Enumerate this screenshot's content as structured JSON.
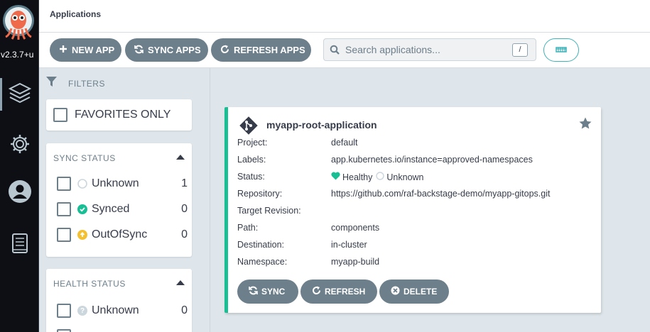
{
  "nav": {
    "version": "v2.3.7+u",
    "items": [
      "applications-icon",
      "settings-icon",
      "user-icon",
      "docs-icon"
    ]
  },
  "header": {
    "title": "Applications"
  },
  "toolbar": {
    "new_app": "NEW APP",
    "sync_apps": "SYNC APPS",
    "refresh_apps": "REFRESH APPS",
    "search_placeholder": "Search applications...",
    "search_shortcut": "/"
  },
  "filters": {
    "label": "FILTERS",
    "favorites": "FAVORITES ONLY",
    "sync_status": {
      "title": "SYNC STATUS",
      "items": [
        {
          "label": "Unknown",
          "count": "1"
        },
        {
          "label": "Synced",
          "count": "0"
        },
        {
          "label": "OutOfSync",
          "count": "0"
        }
      ]
    },
    "health_status": {
      "title": "HEALTH STATUS",
      "items": [
        {
          "label": "Unknown",
          "count": "0"
        }
      ]
    }
  },
  "app": {
    "name": "myapp-root-application",
    "fields": {
      "project_key": "Project:",
      "project": "default",
      "labels_key": "Labels:",
      "labels": "app.kubernetes.io/instance=approved-namespaces",
      "status_key": "Status:",
      "health": "Healthy",
      "sync": "Unknown",
      "repo_key": "Repository:",
      "repo": "https://github.com/raf-backstage-demo/myapp-gitops.git",
      "target_key": "Target Revision:",
      "target": "",
      "path_key": "Path:",
      "path": "components",
      "dest_key": "Destination:",
      "dest": "in-cluster",
      "ns_key": "Namespace:",
      "ns": "myapp-build"
    },
    "actions": {
      "sync": "SYNC",
      "refresh": "REFRESH",
      "delete": "DELETE"
    }
  },
  "colors": {
    "healthy": "#18be94",
    "synced": "#18be94",
    "outofsync": "#f4c030",
    "accent": "#3fb3b8",
    "nav_bg": "#0d0f14"
  }
}
